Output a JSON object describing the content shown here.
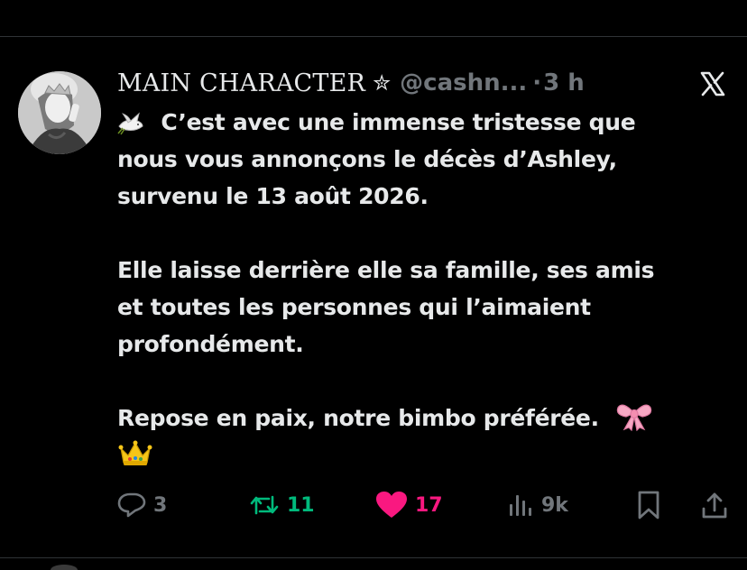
{
  "post": {
    "author": {
      "display_name": "MAIN CHARACTER",
      "badge": "✮",
      "handle": "@cashn...",
      "separator": "·",
      "time": "3 h"
    },
    "platform_icon": "x-logo-icon",
    "body": {
      "line1": "C’est avec une immense tristesse que",
      "line2": "nous vous annonçons le décès d’Ashley,",
      "line3": "survenu le 13 août 2026.",
      "line4": "Elle laisse derrière elle sa famille, ses amis",
      "line5": "et toutes les personnes qui l’aimaient",
      "line6": "profondément.",
      "line7": "Repose en paix, notre bimbo préférée."
    },
    "emojis": {
      "dove": "dove-emoji",
      "ribbon": "ribbon-emoji",
      "crown": "crown-emoji"
    },
    "actions": {
      "replies": "3",
      "reposts": "11",
      "likes": "17",
      "views": "9k"
    },
    "colors": {
      "background": "#000000",
      "text": "#e7e9ea",
      "muted": "#71767b",
      "repost": "#00ba7c",
      "like": "#f91880",
      "divider": "#2f3336"
    }
  }
}
